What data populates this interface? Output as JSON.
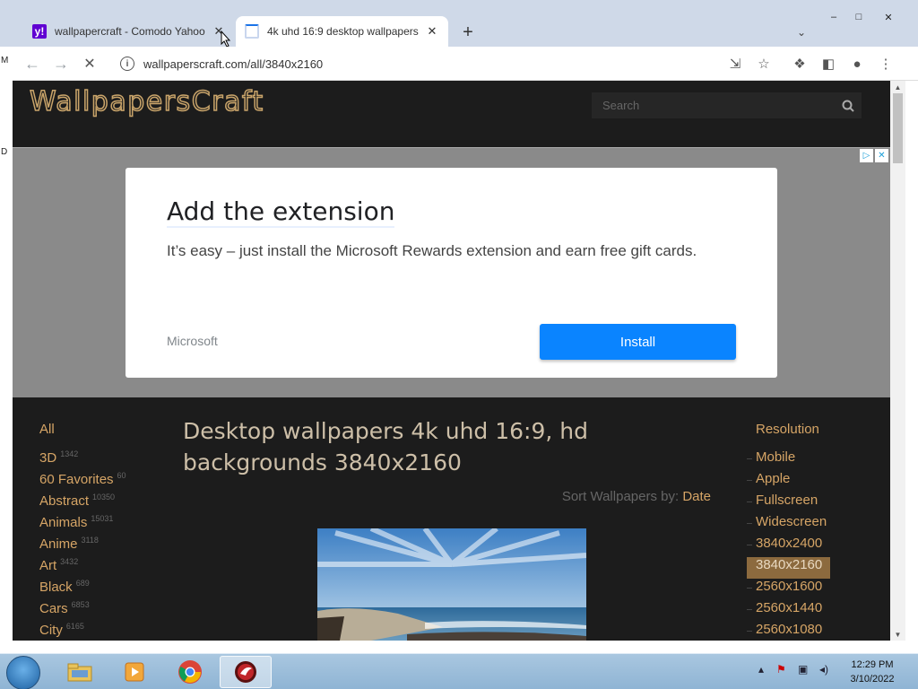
{
  "browser": {
    "tabs": [
      {
        "title": "wallpapercraft - Comodo Yahoo",
        "favicon": "yahoo-icon",
        "favicon_text": "y!",
        "active": false
      },
      {
        "title": "4k uhd 16:9 desktop wallpapers",
        "favicon": "loading-spinner-icon",
        "active": true
      }
    ],
    "url": "wallpaperscraft.com/all/3840x2160"
  },
  "site": {
    "logo": "WallpapersCraft",
    "search_placeholder": "Search"
  },
  "ad": {
    "headline": "Add the extension",
    "body": "It’s easy – just install the Microsoft Rewards extension and earn free gift cards.",
    "brand": "Microsoft",
    "cta": "Install"
  },
  "page": {
    "title": "Desktop wallpapers 4k uhd 16:9, hd backgrounds 3840x2160",
    "sort_label": "Sort Wallpapers by:",
    "sort_value": "Date"
  },
  "categories": {
    "all_label": "All",
    "items": [
      {
        "name": "3D",
        "count": "1342"
      },
      {
        "name": "60 Favorites",
        "count": "60"
      },
      {
        "name": "Abstract",
        "count": "10350"
      },
      {
        "name": "Animals",
        "count": "15031"
      },
      {
        "name": "Anime",
        "count": "3118"
      },
      {
        "name": "Art",
        "count": "3432"
      },
      {
        "name": "Black",
        "count": "689"
      },
      {
        "name": "Cars",
        "count": "6853"
      },
      {
        "name": "City",
        "count": "6165"
      }
    ]
  },
  "resolution": {
    "heading": "Resolution",
    "items": [
      {
        "label": "Mobile",
        "selected": false
      },
      {
        "label": "Apple",
        "selected": false
      },
      {
        "label": "Fullscreen",
        "selected": false
      },
      {
        "label": "Widescreen",
        "selected": false
      },
      {
        "label": "3840x2400",
        "selected": false
      },
      {
        "label": "3840x2160",
        "selected": true
      },
      {
        "label": "2560x1600",
        "selected": false
      },
      {
        "label": "2560x1440",
        "selected": false
      },
      {
        "label": "2560x1080",
        "selected": false
      }
    ]
  },
  "desktop": {
    "left_edge_letters": [
      "M",
      "D"
    ]
  },
  "taskbar": {
    "apps": [
      "file-explorer-icon",
      "media-player-icon",
      "chrome-icon",
      "comodo-dragon-icon"
    ],
    "time": "12:29 PM",
    "date": "3/10/2022"
  },
  "colors": {
    "accent": "#d6a566",
    "selected_bg": "#8c6a3e",
    "site_bg": "#1c1c1c",
    "install_button": "#0a84ff"
  }
}
